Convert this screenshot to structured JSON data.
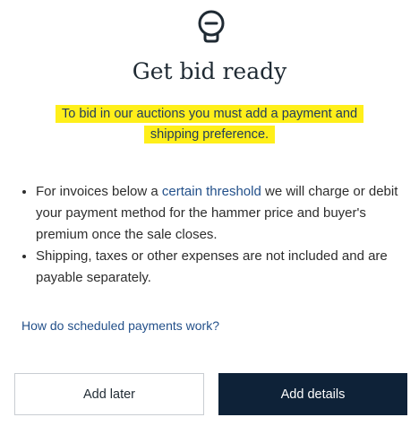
{
  "header": {
    "icon": "bulb-info-icon",
    "title": "Get bid ready"
  },
  "notice": {
    "line1": "To bid in our auctions you must add a payment and",
    "line2": "shipping preference."
  },
  "bullets": {
    "item1_prefix": "For invoices below a ",
    "item1_link": "certain threshold",
    "item1_suffix": " we will charge or debit your payment method for the hammer price and buyer's premium once the sale closes.",
    "item2": "Shipping, taxes or other expenses are not included and are payable separately."
  },
  "faq_link": "How do scheduled payments work?",
  "actions": {
    "add_later": "Add later",
    "add_details": "Add details"
  },
  "colors": {
    "primary": "#0e2238",
    "link": "#23508a",
    "highlight": "#ffef1a"
  }
}
